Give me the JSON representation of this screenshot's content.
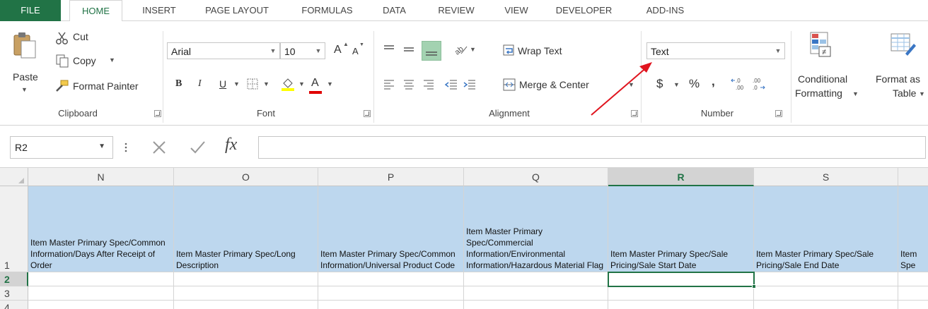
{
  "tabs": [
    "FILE",
    "HOME",
    "INSERT",
    "PAGE LAYOUT",
    "FORMULAS",
    "DATA",
    "REVIEW",
    "VIEW",
    "DEVELOPER",
    "ADD-INS"
  ],
  "clipboard": {
    "paste": "Paste",
    "cut": "Cut",
    "copy": "Copy",
    "format_painter": "Format Painter",
    "label": "Clipboard"
  },
  "font": {
    "name": "Arial",
    "size": "10",
    "bold": "B",
    "italic": "I",
    "underline": "U",
    "grow": "A",
    "shrink": "A",
    "color_a": "A",
    "label": "Font"
  },
  "alignment": {
    "wrap_text": "Wrap Text",
    "merge_center": "Merge & Center",
    "label": "Alignment"
  },
  "number": {
    "format": "Text",
    "currency": "$",
    "percent": "%",
    "comma": ",",
    "label": "Number"
  },
  "styles": {
    "conditional_line1": "Conditional",
    "conditional_line2": "Formatting",
    "format_as_line1": "Format as",
    "format_as_line2": "Table"
  },
  "formula_bar": {
    "name_box": "R2",
    "fx": "fx",
    "value": ""
  },
  "columns": [
    "N",
    "O",
    "P",
    "Q",
    "R",
    "S"
  ],
  "rows": [
    "1",
    "2",
    "3",
    "4"
  ],
  "header_cells": [
    "Item Master Primary Spec/Common Information/Days After Receipt of Order",
    "Item Master Primary Spec/Long Description",
    "Item Master Primary Spec/Common Information/Universal Product Code",
    "Item Master Primary Spec/Commercial Information/Environmental Information/Hazardous Material Flag",
    "Item Master Primary Spec/Sale Pricing/Sale Start Date",
    "Item Master Primary Spec/Sale Pricing/Sale End Date",
    "Item Spe"
  ],
  "colors": {
    "accent": "#217346",
    "header_fill": "#bdd7ee",
    "arrow": "#e0141e"
  }
}
